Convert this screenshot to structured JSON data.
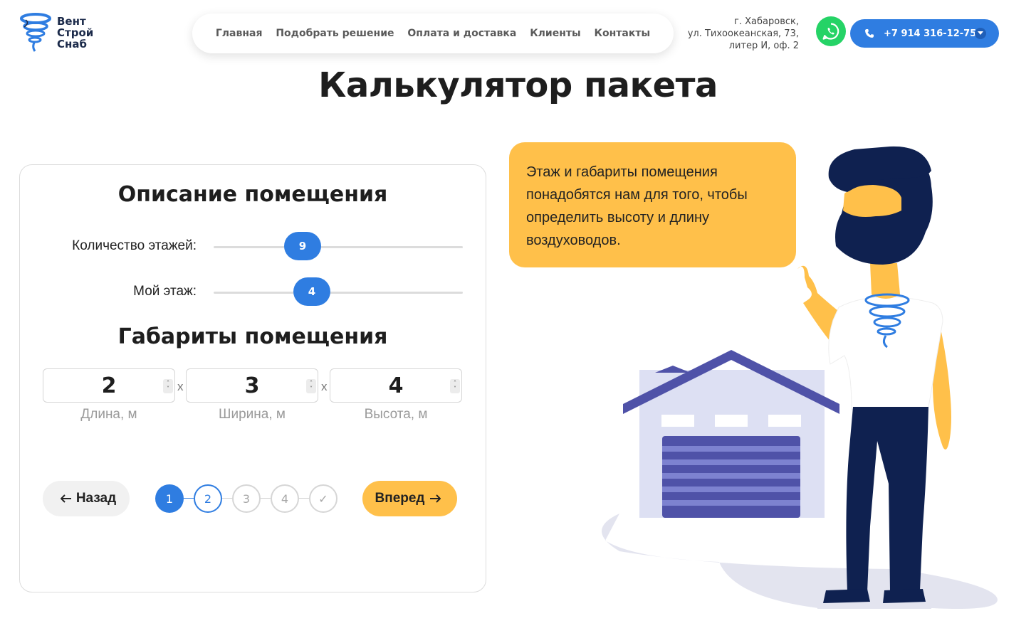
{
  "logo": {
    "lines": [
      "Вент",
      "Строй",
      "Снаб"
    ]
  },
  "nav": {
    "items": [
      {
        "label": "Главная"
      },
      {
        "label": "Подобрать решение"
      },
      {
        "label": "Оплата и доставка"
      },
      {
        "label": "Клиенты"
      },
      {
        "label": "Контакты"
      }
    ]
  },
  "contacts": {
    "address_lines": [
      "г. Хабаровск,",
      "ул. Тихоокеанская, 73,",
      "литер И, оф. 2"
    ],
    "phone": "+7 914 316-12-75",
    "whatsapp_icon": "whatsapp-icon",
    "phone_icon": "phone-icon"
  },
  "page_title": "Калькулятор пакета",
  "form": {
    "room_section_title": "Описание помещения",
    "floors": {
      "label": "Количество этажей:",
      "value": "9"
    },
    "my_floor": {
      "label": "Мой этаж:",
      "value": "4"
    },
    "dims_section_title": "Габариты помещения",
    "separator": "x",
    "dimensions": [
      {
        "value": "2",
        "caption": "Длина, м"
      },
      {
        "value": "3",
        "caption": "Ширина, м"
      },
      {
        "value": "4",
        "caption": "Высота, м"
      }
    ],
    "back_label": "Назад",
    "next_label": "Вперед",
    "steps": [
      {
        "label": "1",
        "state": "active"
      },
      {
        "label": "2",
        "state": "next"
      },
      {
        "label": "3",
        "state": "todo"
      },
      {
        "label": "4",
        "state": "todo"
      },
      {
        "label": "✓",
        "state": "todo"
      }
    ]
  },
  "bubble_text": "Этаж и габариты помещения понадобятся нам для того, чтобы определить высоту и длину воздуховодов.",
  "colors": {
    "accent_blue": "#2f7de1",
    "accent_yellow": "#ffc04a",
    "navy": "#0f2150",
    "house_purple": "#4f52a8"
  }
}
